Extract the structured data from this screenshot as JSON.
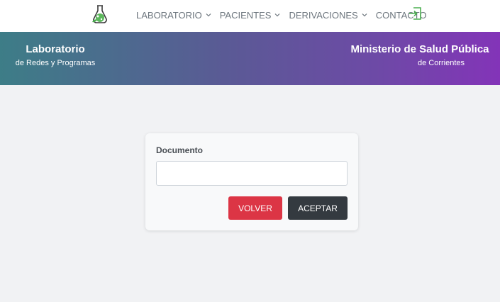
{
  "nav": {
    "logo_icon": "flask-leaf-icon",
    "items": [
      {
        "label": "LABORATORIO",
        "has_dropdown": true
      },
      {
        "label": "PACIENTES",
        "has_dropdown": true
      },
      {
        "label": "DERIVACIONES",
        "has_dropdown": true
      },
      {
        "label": "CONTACTO",
        "has_dropdown": false
      }
    ],
    "exit_icon": "sign-in-icon"
  },
  "banner": {
    "left_title": "Laboratorio",
    "left_subtitle": "de Redes y Programas",
    "right_title": "Ministerio de Salud Pública",
    "right_subtitle": "de Corrientes"
  },
  "form": {
    "label": "Documento",
    "value": "",
    "placeholder": "",
    "cancel_label": "VOLVER",
    "submit_label": "ACEPTAR"
  },
  "colors": {
    "accent_green": "#4caf50",
    "danger": "#dc3545",
    "dark": "#343a40",
    "gradient_start": "#3d7d87",
    "gradient_end": "#8334b8"
  }
}
